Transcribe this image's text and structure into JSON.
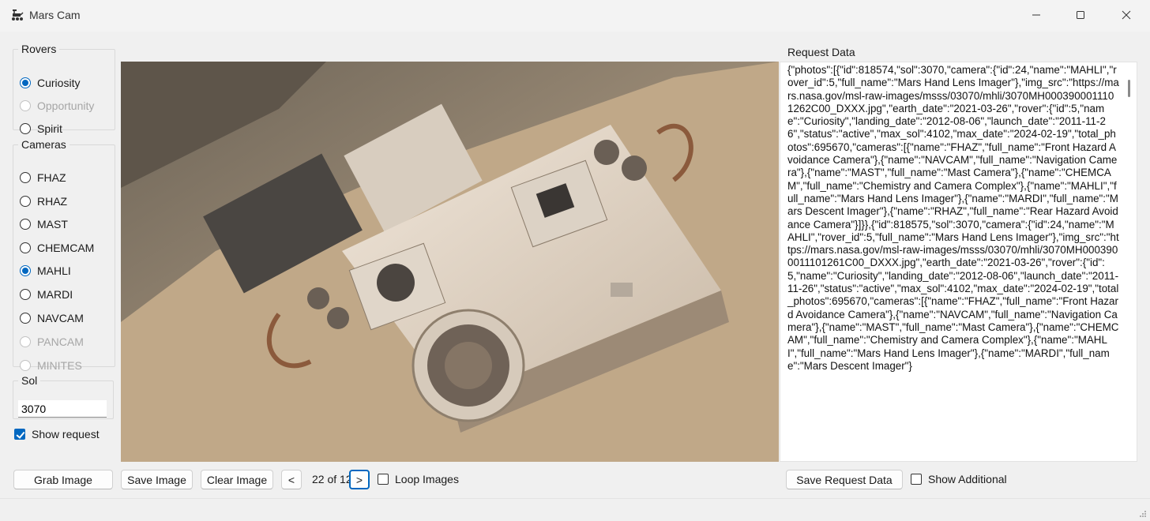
{
  "window": {
    "title": "Mars Cam",
    "icon": "rover-icon",
    "controls": [
      "minimize-icon",
      "maximize-icon",
      "close-icon"
    ]
  },
  "rovers": {
    "legend": "Rovers",
    "options": [
      {
        "label": "Curiosity",
        "checked": true,
        "disabled": false
      },
      {
        "label": "Opportunity",
        "checked": false,
        "disabled": true
      },
      {
        "label": "Spirit",
        "checked": false,
        "disabled": false
      }
    ]
  },
  "cameras": {
    "legend": "Cameras",
    "options": [
      {
        "label": "FHAZ",
        "checked": false,
        "disabled": false
      },
      {
        "label": "RHAZ",
        "checked": false,
        "disabled": false
      },
      {
        "label": "MAST",
        "checked": false,
        "disabled": false
      },
      {
        "label": "CHEMCAM",
        "checked": false,
        "disabled": false
      },
      {
        "label": "MAHLI",
        "checked": true,
        "disabled": false
      },
      {
        "label": "MARDI",
        "checked": false,
        "disabled": false
      },
      {
        "label": "NAVCAM",
        "checked": false,
        "disabled": false
      },
      {
        "label": "PANCAM",
        "checked": false,
        "disabled": true
      },
      {
        "label": "MINITES",
        "checked": false,
        "disabled": true
      }
    ]
  },
  "sol": {
    "legend": "Sol",
    "value": "3070"
  },
  "show_request": {
    "label": "Show request",
    "checked": true
  },
  "toolbar": {
    "grab_label": "Grab Image",
    "save_label": "Save Image",
    "clear_label": "Clear Image",
    "prev_label": "<",
    "next_label": ">",
    "page_counter": "22 of 12",
    "loop_label": "Loop Images",
    "loop_checked": false
  },
  "request": {
    "label": "Request Data",
    "text": "{\"photos\":[{\"id\":818574,\"sol\":3070,\"camera\":{\"id\":24,\"name\":\"MAHLI\",\"rover_id\":5,\"full_name\":\"Mars Hand Lens Imager\"},\"img_src\":\"https://mars.nasa.gov/msl-raw-images/msss/03070/mhli/3070MH0003900011101262C00_DXXX.jpg\",\"earth_date\":\"2021-03-26\",\"rover\":{\"id\":5,\"name\":\"Curiosity\",\"landing_date\":\"2012-08-06\",\"launch_date\":\"2011-11-26\",\"status\":\"active\",\"max_sol\":4102,\"max_date\":\"2024-02-19\",\"total_photos\":695670,\"cameras\":[{\"name\":\"FHAZ\",\"full_name\":\"Front Hazard Avoidance Camera\"},{\"name\":\"NAVCAM\",\"full_name\":\"Navigation Camera\"},{\"name\":\"MAST\",\"full_name\":\"Mast Camera\"},{\"name\":\"CHEMCAM\",\"full_name\":\"Chemistry and Camera Complex\"},{\"name\":\"MAHLI\",\"full_name\":\"Mars Hand Lens Imager\"},{\"name\":\"MARDI\",\"full_name\":\"Mars Descent Imager\"},{\"name\":\"RHAZ\",\"full_name\":\"Rear Hazard Avoidance Camera\"}]}},{\"id\":818575,\"sol\":3070,\"camera\":{\"id\":24,\"name\":\"MAHLI\",\"rover_id\":5,\"full_name\":\"Mars Hand Lens Imager\"},\"img_src\":\"https://mars.nasa.gov/msl-raw-images/msss/03070/mhli/3070MH0003900011101261C00_DXXX.jpg\",\"earth_date\":\"2021-03-26\",\"rover\":{\"id\":5,\"name\":\"Curiosity\",\"landing_date\":\"2012-08-06\",\"launch_date\":\"2011-11-26\",\"status\":\"active\",\"max_sol\":4102,\"max_date\":\"2024-02-19\",\"total_photos\":695670,\"cameras\":[{\"name\":\"FHAZ\",\"full_name\":\"Front Hazard Avoidance Camera\"},{\"name\":\"NAVCAM\",\"full_name\":\"Navigation Camera\"},{\"name\":\"MAST\",\"full_name\":\"Mast Camera\"},{\"name\":\"CHEMCAM\",\"full_name\":\"Chemistry and Camera Complex\"},{\"name\":\"MAHLI\",\"full_name\":\"Mars Hand Lens Imager\"},{\"name\":\"MARDI\",\"full_name\":\"Mars Descent Imager\"}",
    "save_label": "Save Request Data",
    "show_additional_label": "Show Additional",
    "show_additional_checked": false
  },
  "colors": {
    "accent": "#0067c0",
    "window_bg": "#f0f0f0",
    "disabled_text": "#a6a6a6"
  }
}
